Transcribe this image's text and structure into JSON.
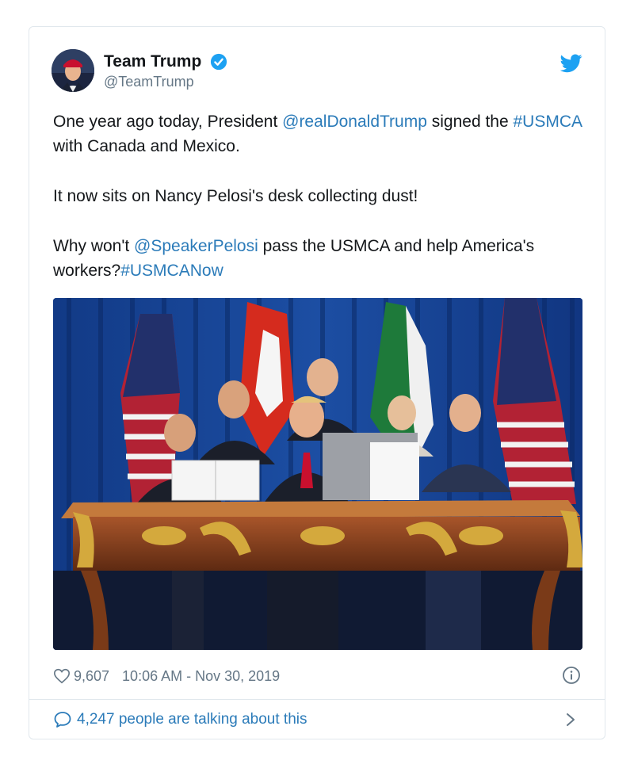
{
  "tweet": {
    "display_name": "Team Trump",
    "handle": "@TeamTrump",
    "verified": true,
    "text": {
      "p1_pre": "One year ago today, President ",
      "p1_mention": "@realDonaldTrump",
      "p1_mid": " signed the ",
      "p1_hashtag": "#USMCA",
      "p1_post": " with Canada and Mexico.",
      "p2": "It now sits on Nancy Pelosi's desk collecting dust!",
      "p3_pre": "Why won't ",
      "p3_mention": "@SpeakerPelosi",
      "p3_mid": " pass the USMCA and help America's workers?",
      "p3_hashtag": "#USMCANow"
    },
    "likes": "9,607",
    "timestamp": "10:06 AM - Nov 30, 2019",
    "footer_text": "4,247 people are talking about this"
  },
  "icons": {
    "verified": "verified-badge-icon",
    "brand": "twitter-bird-icon",
    "like": "heart-icon",
    "info": "info-icon",
    "reply": "speech-bubble-icon",
    "more": "chevron-right-icon"
  },
  "colors": {
    "link": "#2b7bb9",
    "muted": "#657786",
    "twitter_blue": "#1da1f2",
    "border": "#e1e8ed"
  }
}
